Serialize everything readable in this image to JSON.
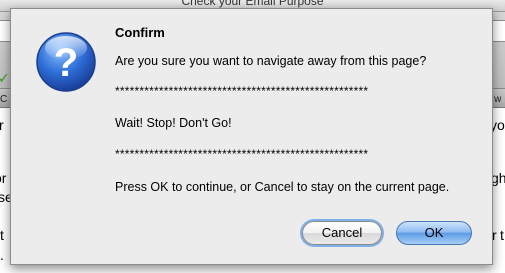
{
  "background": {
    "window_title": "Check your Email Purpose",
    "fragments": {
      "left_c": "C",
      "left_r": "r",
      "left_or": "or",
      "left_se": "se",
      "left_t": "t",
      "left_dot": ".",
      "right_at": "at w",
      "right_you": "you",
      "right_ght": "ght",
      "right_r": "r",
      "right_t": "t"
    }
  },
  "dialog": {
    "title": "Confirm",
    "question": "Are you sure you want to navigate away from this page?",
    "separator_top": "****************************************************",
    "message": "Wait! Stop! Don't Go!",
    "separator_bottom": "****************************************************",
    "instructions": "Press OK to continue, or Cancel to stay on the current page.",
    "cancel_label": "Cancel",
    "ok_label": "OK"
  },
  "colors": {
    "icon_blue": "#2f6fd8",
    "ok_blue": "#6aa6ee",
    "focus_ring": "#7fb0e8"
  },
  "icons": {
    "alert": "question-mark-icon"
  }
}
